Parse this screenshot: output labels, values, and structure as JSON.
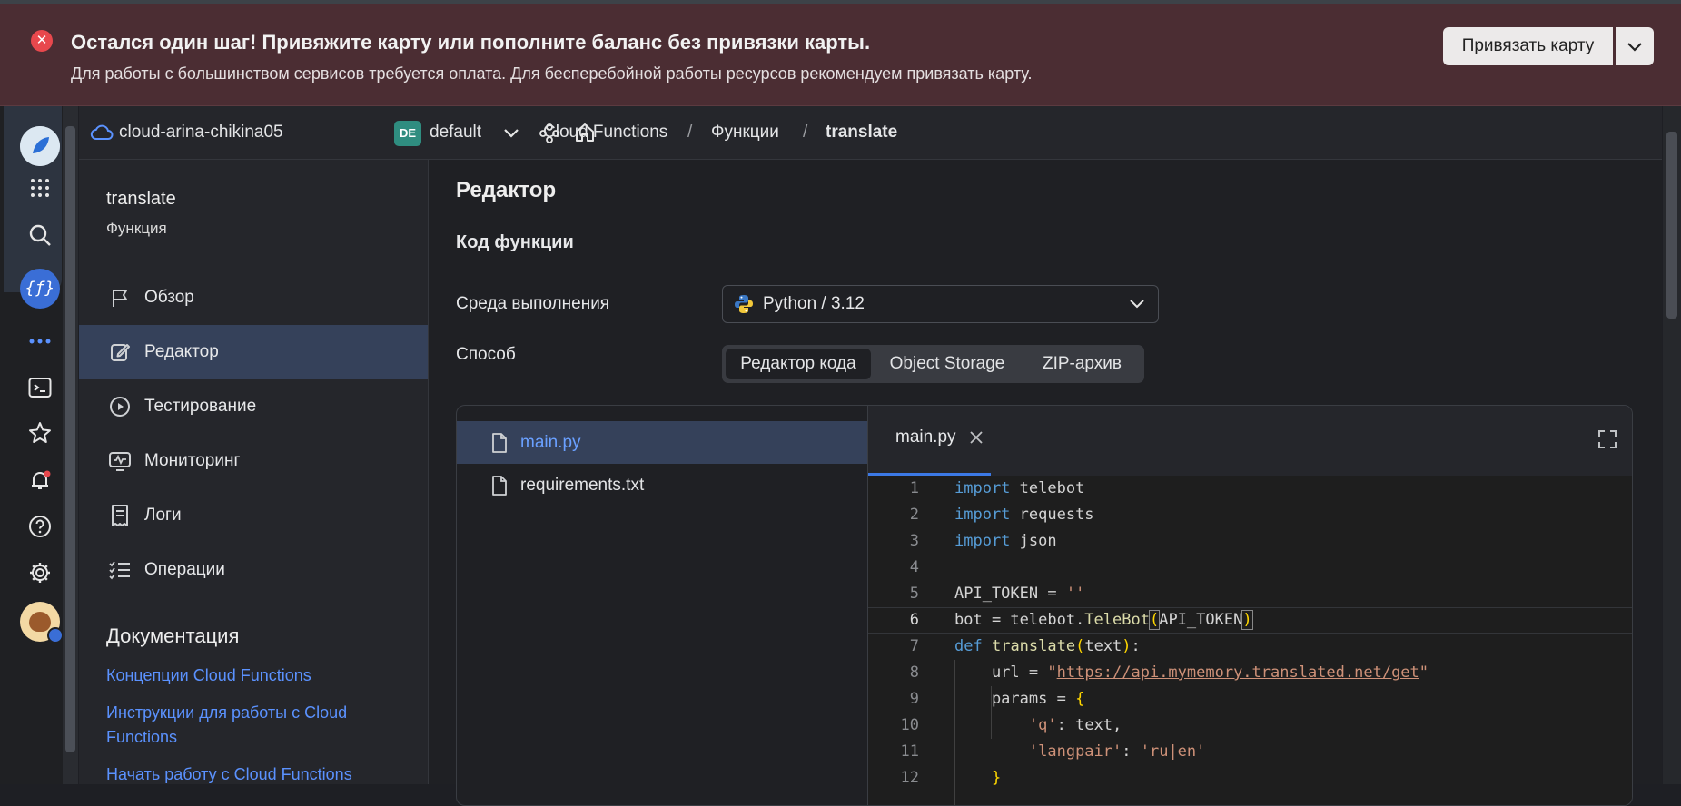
{
  "banner": {
    "title": "Остался один шаг! Привяжите карту или пополните баланс без привязки карты.",
    "text": "Для работы с большинством сервисов требуется оплата. Для бесперебойной работы ресурсов рекомендуем привязать карту.",
    "button": "Привязать карту"
  },
  "header": {
    "cloud": "cloud-arina-chikina05",
    "folder_badge": "DE",
    "folder": "default",
    "breadcrumbs": [
      "Cloud Functions",
      "Функции",
      "translate"
    ],
    "separator": "/"
  },
  "sidebar": {
    "title": "translate",
    "subtitle": "Функция",
    "items": [
      {
        "label": "Обзор",
        "icon": "flag-icon"
      },
      {
        "label": "Редактор",
        "icon": "edit-icon",
        "active": true
      },
      {
        "label": "Тестирование",
        "icon": "play-icon"
      },
      {
        "label": "Мониторинг",
        "icon": "monitor-icon"
      },
      {
        "label": "Логи",
        "icon": "receipt-icon"
      },
      {
        "label": "Операции",
        "icon": "checklist-icon"
      }
    ],
    "docs_heading": "Документация",
    "doc_links": [
      "Концепции Cloud Functions",
      "Инструкции для работы с Cloud Functions",
      "Начать работу с Cloud Functions"
    ]
  },
  "main": {
    "title": "Редактор",
    "section": "Код функции",
    "runtime_label": "Среда выполнения",
    "runtime_value": "Python / 3.12",
    "method_label": "Способ",
    "method_options": [
      "Редактор кода",
      "Object Storage",
      "ZIP-архив"
    ],
    "method_selected": "Редактор кода"
  },
  "editor": {
    "files": [
      "main.py",
      "requirements.txt"
    ],
    "active_file": "main.py",
    "tab": "main.py",
    "current_line": 6,
    "line_numbers": [
      "1",
      "2",
      "3",
      "4",
      "5",
      "6",
      "7",
      "8",
      "9",
      "10",
      "11",
      "12"
    ]
  },
  "colors": {
    "banner_bg": "#4b2d33",
    "accent": "#3c79e6",
    "link": "#5b92ff",
    "active_nav": "#35415a"
  }
}
